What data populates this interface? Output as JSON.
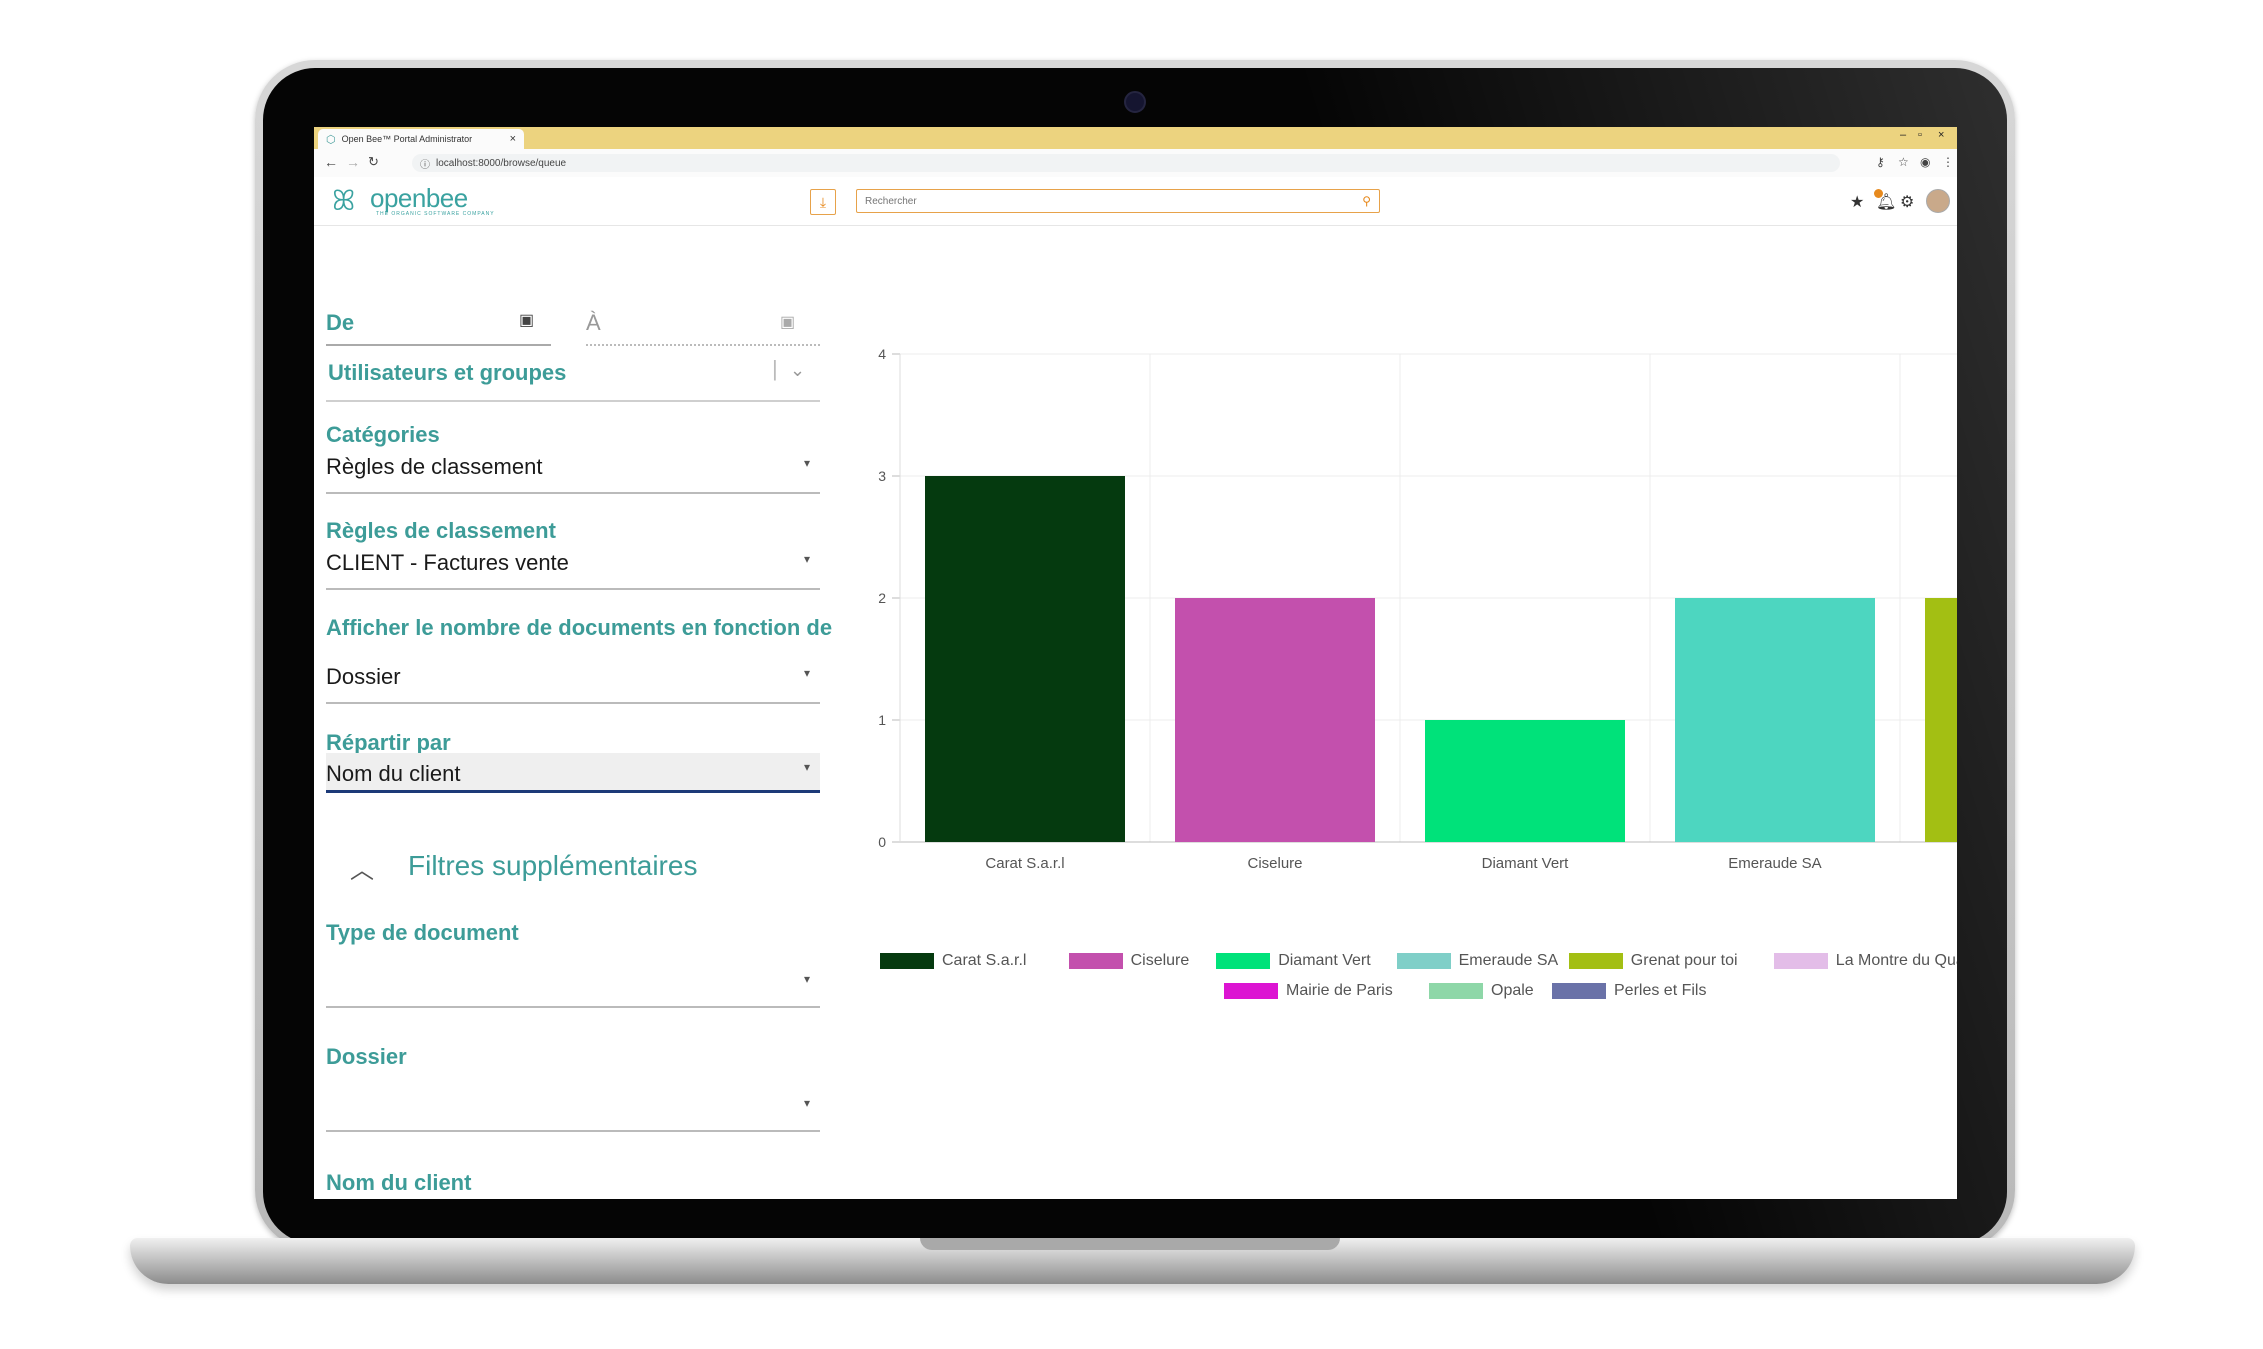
{
  "browser": {
    "tab_title": "Open Bee™ Portal Administrator",
    "tab_close": "×",
    "url": "localhost:8000/browse/queue",
    "window_controls": [
      "–",
      "▫",
      "×"
    ]
  },
  "header": {
    "logo_text": "openbee",
    "logo_tagline": "THE ORGANIC SOFTWARE COMPANY",
    "search_placeholder": "Rechercher",
    "icons": [
      "download-icon",
      "search-icon",
      "star-icon",
      "bell-icon",
      "gear-icon",
      "avatar"
    ]
  },
  "form": {
    "date_from_label": "De",
    "date_to_label": "À",
    "users_groups_label": "Utilisateurs et groupes",
    "categories_label": "Catégories",
    "categories_value": "Règles de classement",
    "rules_label": "Règles de classement",
    "rules_value": "CLIENT - Factures vente",
    "count_by_label": "Afficher le nombre de documents en fonction de",
    "count_by_value": "Dossier",
    "split_by_label": "Répartir par",
    "split_by_value": "Nom du client",
    "extra_filters_label": "Filtres supplémentaires",
    "doc_type_label": "Type de document",
    "folder_label": "Dossier",
    "client_name_label": "Nom du client"
  },
  "chart_data": {
    "type": "bar",
    "categories": [
      "Carat S.a.r.l",
      "Ciselure",
      "Diamant Vert",
      "Emeraude SA",
      "Grenat pour toi"
    ],
    "values": [
      3,
      2,
      1,
      2,
      2
    ],
    "colors": [
      "#053a0f",
      "#c350ad",
      "#00e27a",
      "#4dd6c0",
      "#a3bf13"
    ],
    "ylim": [
      0,
      4
    ],
    "yticks": [
      "0",
      "1",
      "2",
      "3",
      "4"
    ],
    "grid": true,
    "legend_position": "bottom",
    "legend": [
      {
        "name": "Carat S.a.r.l",
        "color": "#053a0f"
      },
      {
        "name": "Ciselure",
        "color": "#c350ad"
      },
      {
        "name": "Diamant Vert",
        "color": "#00e27a"
      },
      {
        "name": "Emeraude SA",
        "color": "#7fcfc8"
      },
      {
        "name": "Grenat pour toi",
        "color": "#a3bf13"
      },
      {
        "name": "La Montre du Quartier",
        "color": "#e3bde8"
      },
      {
        "name": "",
        "color": "#3c5c8a"
      },
      {
        "name": "Mairie de Paris",
        "color": "#dc14d2"
      },
      {
        "name": "Opale",
        "color": "#8ed7a8"
      },
      {
        "name": "Perles et Fils",
        "color": "#6a72a8"
      }
    ]
  }
}
